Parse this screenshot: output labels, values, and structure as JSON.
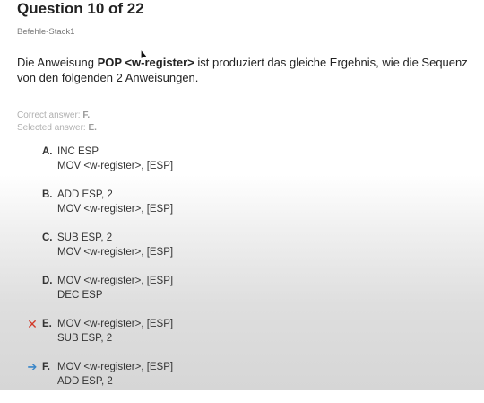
{
  "header": {
    "title": "Question 10 of 22",
    "category": "Befehle-Stack1"
  },
  "question": {
    "text_before": "Die Anweisung ",
    "text_bold": "POP <w-register>",
    "text_after": " ist produziert das gleiche Ergebnis, wie die Sequenz",
    "line2": "von den folgenden 2 Anweisungen."
  },
  "answer_info": {
    "correct_label": "Correct answer: ",
    "correct_value": "F.",
    "selected_label": "Selected answer: ",
    "selected_value": "E."
  },
  "options": [
    {
      "letter": "A.",
      "line1": "INC ESP",
      "line2": "MOV <w-register>, [ESP]",
      "marker": "",
      "marker_type": "none"
    },
    {
      "letter": "B.",
      "line1": "ADD ESP, 2",
      "line2": "MOV <w-register>, [ESP]",
      "marker": "",
      "marker_type": "none"
    },
    {
      "letter": "C.",
      "line1": "SUB ESP, 2",
      "line2": "MOV <w-register>, [ESP]",
      "marker": "",
      "marker_type": "none"
    },
    {
      "letter": "D.",
      "line1": "MOV <w-register>, [ESP]",
      "line2": "DEC ESP",
      "marker": "",
      "marker_type": "none"
    },
    {
      "letter": "E.",
      "line1": "MOV <w-register>, [ESP]",
      "line2": "SUB ESP, 2",
      "marker": "✕",
      "marker_type": "wrong"
    },
    {
      "letter": "F.",
      "line1": "MOV <w-register>, [ESP]",
      "line2": "ADD ESP, 2",
      "marker": "➔",
      "marker_type": "correct"
    }
  ],
  "colors": {
    "wrong_marker": "#d23a2a",
    "correct_marker": "#3a86c8"
  }
}
